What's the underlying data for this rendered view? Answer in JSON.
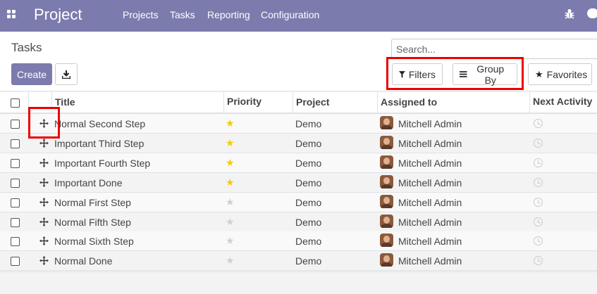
{
  "navbar": {
    "brand": "Project",
    "menu": [
      "Projects",
      "Tasks",
      "Reporting",
      "Configuration"
    ]
  },
  "control": {
    "breadcrumb": "Tasks",
    "create_label": "Create",
    "search_placeholder": "Search...",
    "filters_label": "Filters",
    "groupby_label": "Group By",
    "favorites_label": "Favorites"
  },
  "table": {
    "columns": [
      "Title",
      "Priority",
      "Project",
      "Assigned to",
      "Next Activity"
    ],
    "rows": [
      {
        "title": "Normal Second Step",
        "starred": true,
        "project": "Demo",
        "assigned": "Mitchell Admin"
      },
      {
        "title": "Important Third Step",
        "starred": true,
        "project": "Demo",
        "assigned": "Mitchell Admin"
      },
      {
        "title": "Important Fourth Step",
        "starred": true,
        "project": "Demo",
        "assigned": "Mitchell Admin"
      },
      {
        "title": "Important Done",
        "starred": true,
        "project": "Demo",
        "assigned": "Mitchell Admin"
      },
      {
        "title": "Normal First Step",
        "starred": false,
        "project": "Demo",
        "assigned": "Mitchell Admin"
      },
      {
        "title": "Normal Fifth Step",
        "starred": false,
        "project": "Demo",
        "assigned": "Mitchell Admin"
      },
      {
        "title": "Normal Sixth Step",
        "starred": false,
        "project": "Demo",
        "assigned": "Mitchell Admin"
      },
      {
        "title": "Normal Done",
        "starred": false,
        "project": "Demo",
        "assigned": "Mitchell Admin"
      }
    ]
  },
  "colors": {
    "navbar": "#7c7bad",
    "star_on": "#f3cc00",
    "star_off": "#d0d0d0",
    "highlight": "#ee0000"
  }
}
